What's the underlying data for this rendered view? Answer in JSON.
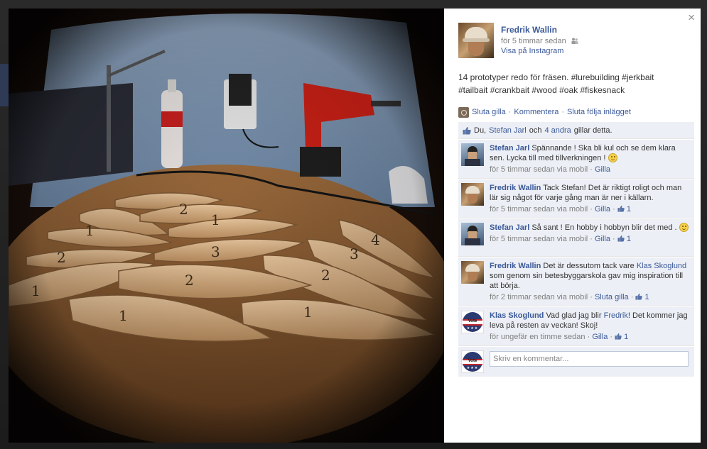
{
  "post": {
    "author": "Fredrik Wallin",
    "time": "för 5 timmar sedan",
    "via": "Visa på Instagram",
    "caption": "14 prototyper redo för fräsen. #lurebuilding #jerkbait #tailbait #crankbait #wood #oak #fiskesnack"
  },
  "actions": {
    "unlike": "Sluta gilla",
    "comment": "Kommentera",
    "unfollow": "Sluta följa inlägget",
    "separator": "·"
  },
  "likes": {
    "prefix": "Du,",
    "person": "Stefan Jarl",
    "middle": "och",
    "others": "4 andra",
    "suffix": "gillar detta."
  },
  "comments": [
    {
      "author": "Stefan Jarl",
      "text": "Spännande ! Ska bli kul och se dem klara sen. Lycka till med tillverkningen !",
      "time": "för 5 timmar sedan via mobil",
      "like_label": "Gilla",
      "like_count": ""
    },
    {
      "author": "Fredrik Wallin",
      "text": "Tack Stefan! Det är riktigt roligt och man lär sig något för varje gång man är ner i källarn.",
      "time": "för 5 timmar sedan via mobil",
      "like_label": "Gilla",
      "like_count": "1"
    },
    {
      "author": "Stefan Jarl",
      "text": "Så sant ! En hobby i hobbyn blir det med .",
      "time": "för 5 timmar sedan via mobil",
      "like_label": "Gilla",
      "like_count": "1"
    },
    {
      "author": "Fredrik Wallin",
      "text_before": "Det är dessutom tack vare",
      "text_link": "Klas Skoglund",
      "text_after": "som genom sin betesbyggarskola gav mig inspiration till att börja.",
      "time": "för 2 timmar sedan via mobil",
      "like_label": "Sluta gilla",
      "like_count": "1"
    },
    {
      "author": "Klas Skoglund",
      "text_before": "Vad glad jag blir",
      "text_link": "Fredrik",
      "text_after": "! Det kommer jag leva på resten av veckan! Skoj!",
      "time": "för ungefär en timme sedan",
      "like_label": "Gilla",
      "like_count": "1"
    }
  ],
  "compose": {
    "placeholder": "Skriv en kommentar..."
  },
  "avatar_text": {
    "vote": "Vote",
    "name": "ThePikeFather"
  },
  "close_symbol": "×",
  "photo_marks": [
    "1",
    "2",
    "3",
    "4",
    "1",
    "2",
    "3",
    "1",
    "2",
    "1",
    "2",
    "1"
  ],
  "colors": {
    "link": "#3b5998",
    "ufi_bg": "#eceff5",
    "meta": "#808080"
  }
}
